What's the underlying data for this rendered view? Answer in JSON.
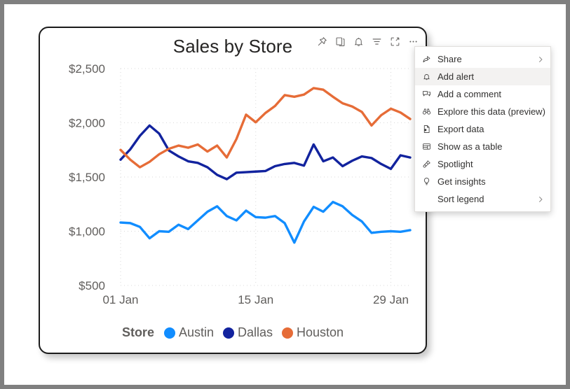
{
  "visual": {
    "title": "Sales by Store"
  },
  "toolbar": {
    "buttons": [
      {
        "name": "pin-icon",
        "tooltip": "Pin visual"
      },
      {
        "name": "copy-icon",
        "tooltip": "Copy visual"
      },
      {
        "name": "bell-icon",
        "tooltip": "Alerts"
      },
      {
        "name": "filter-icon",
        "tooltip": "Filters"
      },
      {
        "name": "focus-mode-icon",
        "tooltip": "Focus mode"
      },
      {
        "name": "more-options-icon",
        "tooltip": "More options"
      }
    ]
  },
  "context_menu": {
    "items": [
      {
        "label": "Share",
        "icon": "share-icon",
        "submenu": true,
        "hovered": false
      },
      {
        "label": "Add alert",
        "icon": "bell-icon",
        "submenu": false,
        "hovered": true
      },
      {
        "label": "Add a comment",
        "icon": "comment-icon",
        "submenu": false,
        "hovered": false
      },
      {
        "label": "Explore this data (preview)",
        "icon": "binoculars-icon",
        "submenu": false,
        "hovered": false
      },
      {
        "label": "Export data",
        "icon": "export-data-icon",
        "submenu": false,
        "hovered": false
      },
      {
        "label": "Show as a table",
        "icon": "table-icon",
        "submenu": false,
        "hovered": false
      },
      {
        "label": "Spotlight",
        "icon": "spotlight-icon",
        "submenu": false,
        "hovered": false
      },
      {
        "label": "Get insights",
        "icon": "lightbulb-icon",
        "submenu": false,
        "hovered": false
      },
      {
        "label": "Sort legend",
        "icon": "none",
        "submenu": true,
        "hovered": false
      }
    ]
  },
  "legend": {
    "title": "Store",
    "items": [
      {
        "label": "Austin",
        "color": "#118DFF"
      },
      {
        "label": "Dallas",
        "color": "#12239E"
      },
      {
        "label": "Houston",
        "color": "#E66C37"
      }
    ]
  },
  "chart_data": {
    "type": "line",
    "title": "Sales by Store",
    "xlabel": "",
    "ylabel": "",
    "grid": true,
    "legend_position": "bottom",
    "ylim": [
      500,
      2500
    ],
    "yticks": [
      500,
      1000,
      1500,
      2000,
      2500
    ],
    "ytick_labels": [
      "$500",
      "$1,000",
      "$1,500",
      "$2,000",
      "$2,500"
    ],
    "x": [
      "01 Jan",
      "02 Jan",
      "03 Jan",
      "04 Jan",
      "05 Jan",
      "06 Jan",
      "07 Jan",
      "08 Jan",
      "09 Jan",
      "10 Jan",
      "11 Jan",
      "12 Jan",
      "13 Jan",
      "14 Jan",
      "15 Jan",
      "16 Jan",
      "17 Jan",
      "18 Jan",
      "19 Jan",
      "20 Jan",
      "21 Jan",
      "22 Jan",
      "23 Jan",
      "24 Jan",
      "25 Jan",
      "26 Jan",
      "27 Jan",
      "28 Jan",
      "29 Jan",
      "30 Jan",
      "31 Jan"
    ],
    "xtick_labels": [
      "01 Jan",
      "15 Jan",
      "29 Jan"
    ],
    "xtick_indices": [
      0,
      14,
      28
    ],
    "series": [
      {
        "name": "Austin",
        "color": "#118DFF",
        "values": [
          1080,
          1075,
          1040,
          935,
          1000,
          995,
          1060,
          1020,
          1100,
          1180,
          1230,
          1140,
          1100,
          1190,
          1130,
          1125,
          1140,
          1075,
          895,
          1090,
          1225,
          1180,
          1270,
          1230,
          1150,
          1090,
          985,
          995,
          1000,
          995,
          1010
        ]
      },
      {
        "name": "Dallas",
        "color": "#12239E",
        "values": [
          1660,
          1755,
          1880,
          1975,
          1900,
          1745,
          1690,
          1645,
          1630,
          1590,
          1520,
          1480,
          1540,
          1545,
          1550,
          1555,
          1600,
          1620,
          1630,
          1605,
          1800,
          1645,
          1680,
          1600,
          1650,
          1690,
          1675,
          1620,
          1575,
          1700,
          1680
        ]
      },
      {
        "name": "Houston",
        "color": "#E66C37",
        "values": [
          1750,
          1660,
          1590,
          1640,
          1710,
          1760,
          1790,
          1770,
          1800,
          1735,
          1790,
          1680,
          1850,
          2075,
          2005,
          2090,
          2155,
          2255,
          2240,
          2260,
          2320,
          2305,
          2240,
          2180,
          2150,
          2100,
          1975,
          2070,
          2130,
          2095,
          2035
        ]
      }
    ]
  }
}
